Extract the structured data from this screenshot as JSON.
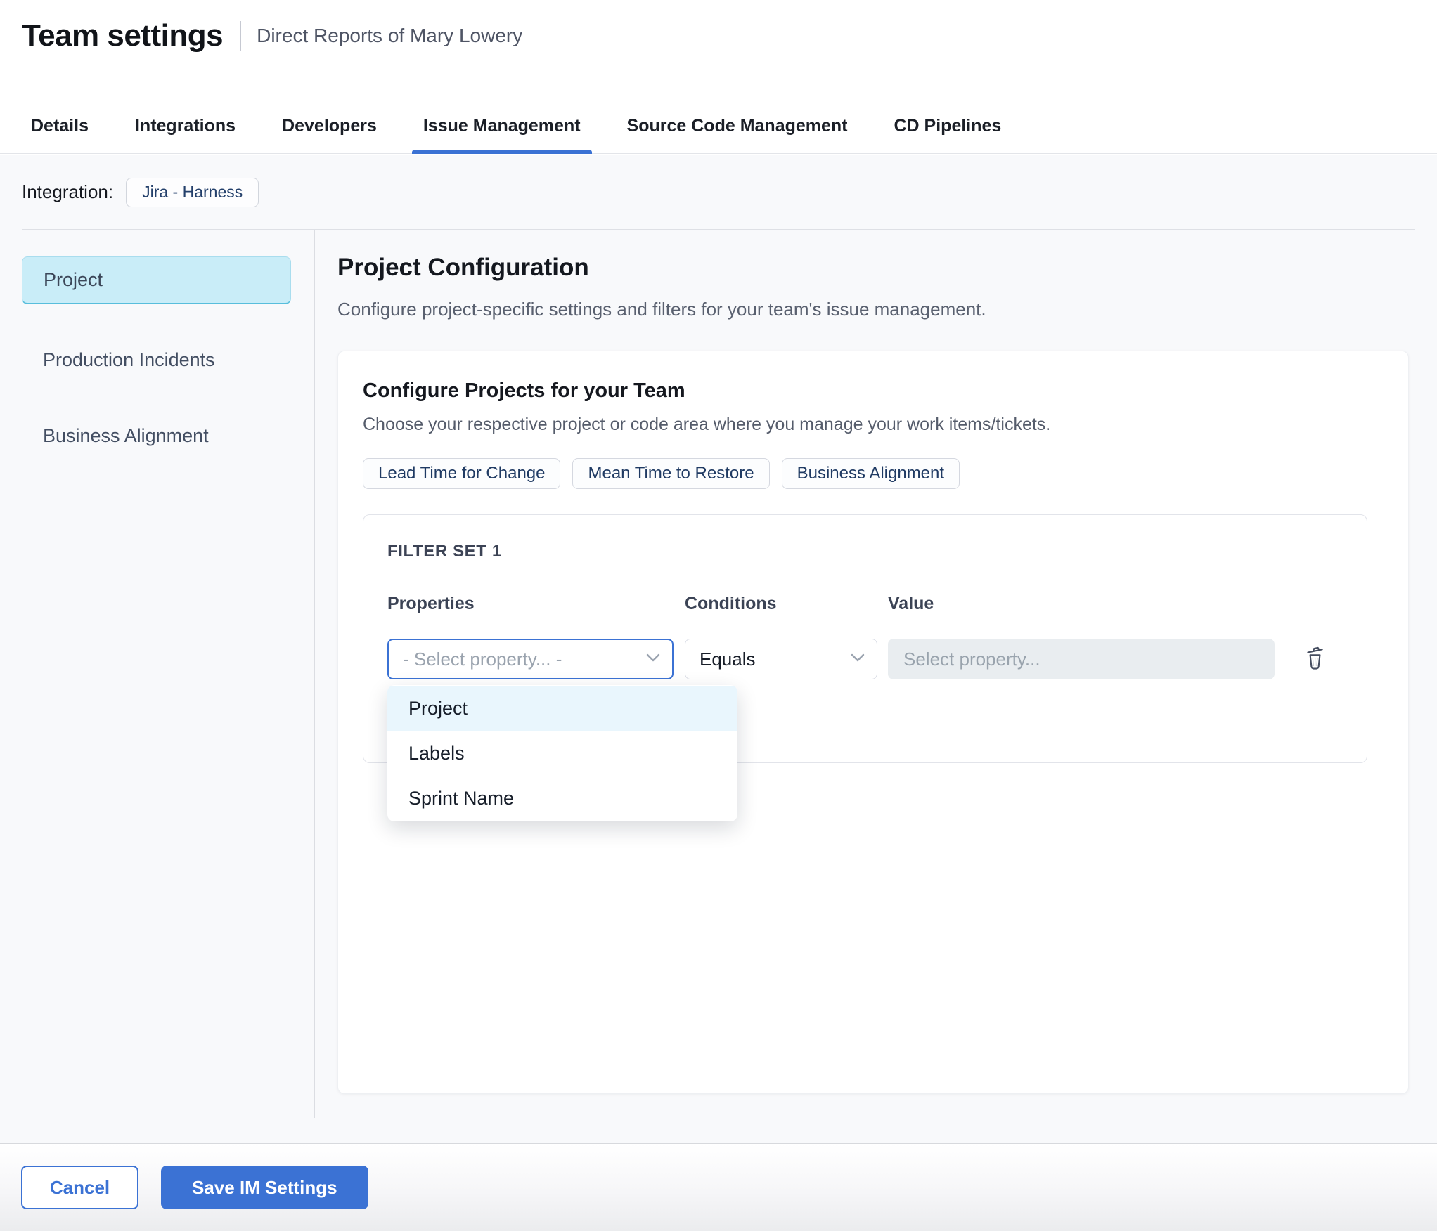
{
  "header": {
    "title": "Team settings",
    "subtitle": "Direct Reports of Mary Lowery"
  },
  "tabs": [
    {
      "label": "Details",
      "active": false
    },
    {
      "label": "Integrations",
      "active": false
    },
    {
      "label": "Developers",
      "active": false
    },
    {
      "label": "Issue Management",
      "active": true
    },
    {
      "label": "Source Code Management",
      "active": false
    },
    {
      "label": "CD Pipelines",
      "active": false
    }
  ],
  "integration": {
    "label": "Integration:",
    "chip": "Jira - Harness"
  },
  "sidebar": {
    "items": [
      {
        "label": "Project",
        "selected": true
      },
      {
        "label": "Production Incidents",
        "selected": false
      },
      {
        "label": "Business Alignment",
        "selected": false
      }
    ]
  },
  "main": {
    "title": "Project Configuration",
    "subtitle": "Configure project-specific settings and filters for your team's issue management.",
    "card": {
      "title": "Configure Projects for your Team",
      "subtitle": "Choose your respective project or code area where you manage your work items/tickets.",
      "chips": [
        {
          "label": "Lead Time for Change"
        },
        {
          "label": "Mean Time to Restore"
        },
        {
          "label": "Business Alignment"
        }
      ],
      "filter_set": {
        "title": "FILTER SET 1",
        "columns": [
          {
            "label": "Properties"
          },
          {
            "label": "Conditions"
          },
          {
            "label": "Value"
          }
        ],
        "properties_placeholder": "- Select property... -",
        "conditions_value": "Equals",
        "value_placeholder": "Select property...",
        "dropdown": {
          "options": [
            {
              "label": "Project",
              "highlighted": true
            },
            {
              "label": "Labels",
              "highlighted": false
            },
            {
              "label": "Sprint Name",
              "highlighted": false
            }
          ]
        }
      }
    }
  },
  "footer": {
    "cancel_label": "Cancel",
    "save_label": "Save IM Settings"
  },
  "colors": {
    "accent_blue": "#3b72d4",
    "selected_sidebar_bg": "#c9edf8",
    "selected_sidebar_border": "#58bedc",
    "dropdown_highlight": "#e9f6fd",
    "content_background": "#f8f9fb",
    "chip_text_navy": "#1f3a63",
    "disabled_input_bg": "#e9edf0"
  }
}
